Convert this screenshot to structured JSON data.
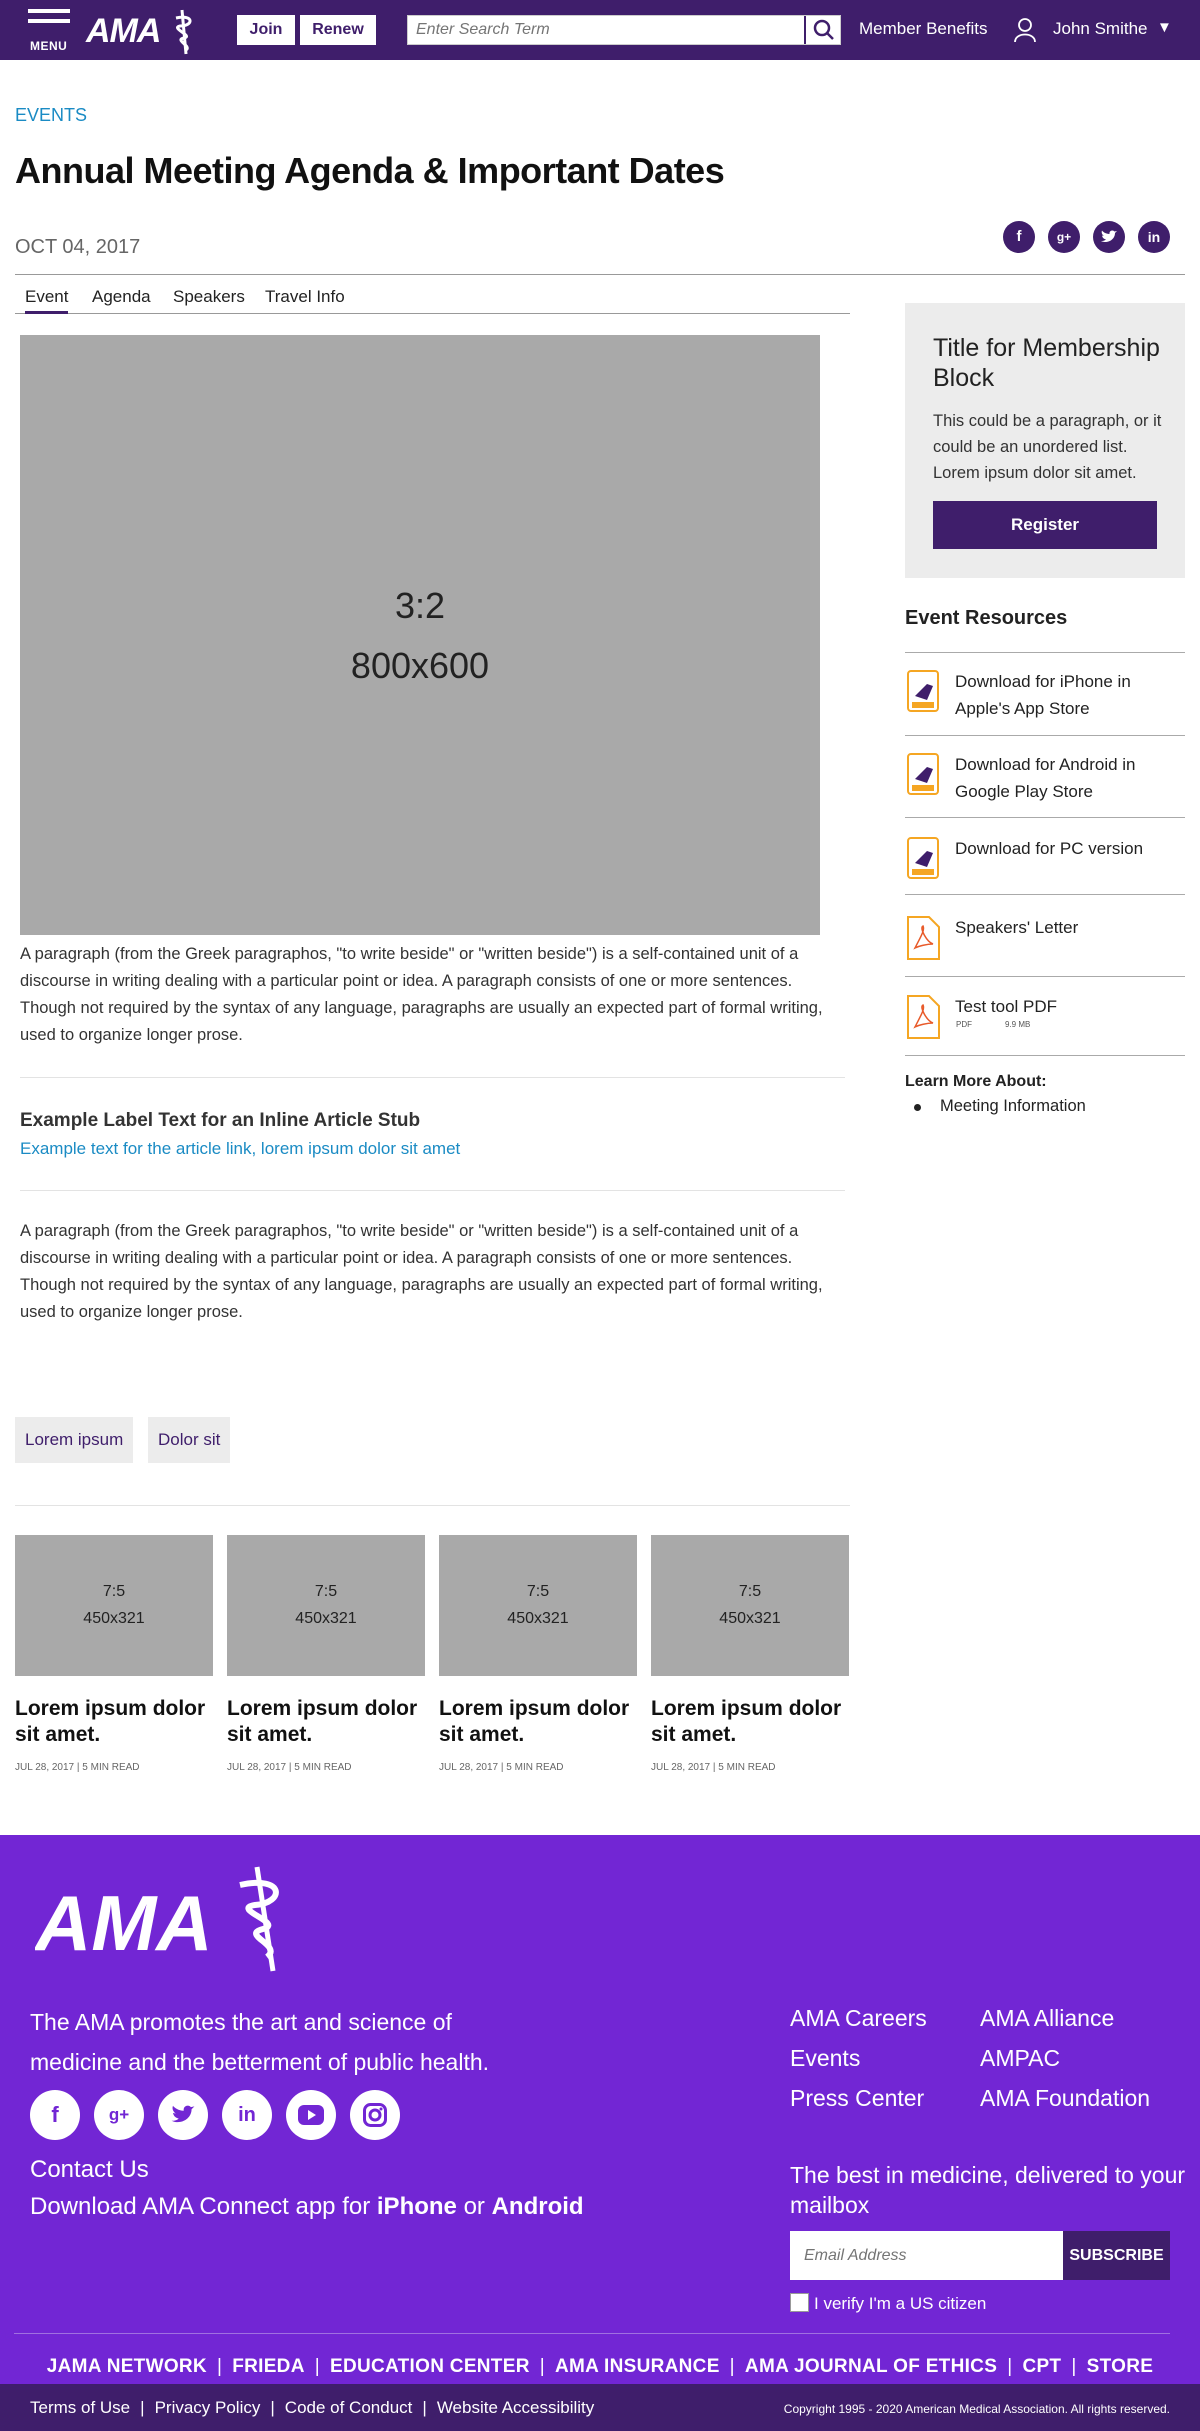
{
  "header": {
    "menu_label": "MENU",
    "logo_text": "AMA",
    "join_label": "Join",
    "renew_label": "Renew",
    "search_placeholder": "Enter Search Term",
    "member_benefits": "Member Benefits",
    "user_name": "John Smithe",
    "user_caret": "▼",
    "brand_color": "#3f1e6b"
  },
  "article": {
    "category": "EVENTS",
    "title": "Annual Meeting Agenda & Important Dates",
    "date": "OCT 04, 2017",
    "social_icons": [
      "facebook-icon",
      "google-plus-icon",
      "twitter-icon",
      "linkedin-icon"
    ],
    "tabs": [
      "Event",
      "Agenda",
      "Speakers",
      "Travel Info"
    ],
    "active_tab": "Event",
    "hero_ratio": "3:2",
    "hero_size": "800x600",
    "paragraph_1": "A paragraph (from the Greek paragraphos, \"to write beside\" or \"written beside\") is a self-contained unit of a discourse in writing dealing with a particular point or idea. A paragraph consists of one or more sentences. Though not required by the syntax of any language, paragraphs are usually an expected part of formal writing, used to organize longer prose.",
    "stub_label": "Example Label Text for an Inline Article Stub",
    "stub_link": "Example text for the article link, lorem ipsum dolor sit amet",
    "paragraph_2": "A paragraph (from the Greek paragraphos, \"to write beside\" or \"written beside\") is a self-contained unit of a discourse in writing dealing with a particular point or idea. A paragraph consists of one or more sentences. Though not required by the syntax of any language, paragraphs are usually an expected part of formal writing, used to organize longer prose.",
    "tags": [
      "Lorem ipsum",
      "Dolor sit"
    ]
  },
  "related_cards": [
    {
      "ratio": "7:5",
      "size": "450x321",
      "title": "Lorem ipsum dolor sit amet.",
      "meta": "JUL 28, 2017 | 5 MIN READ"
    },
    {
      "ratio": "7:5",
      "size": "450x321",
      "title": "Lorem ipsum dolor sit amet.",
      "meta": "JUL 28, 2017 | 5 MIN READ"
    },
    {
      "ratio": "7:5",
      "size": "450x321",
      "title": "Lorem ipsum dolor sit amet.",
      "meta": "JUL 28, 2017 | 5 MIN READ"
    },
    {
      "ratio": "7:5",
      "size": "450x321",
      "title": "Lorem ipsum dolor sit amet.",
      "meta": "JUL 28, 2017 | 5 MIN READ"
    }
  ],
  "sidebar": {
    "membership_title": "Title for Membership Block",
    "membership_text": "This could be a paragraph, or it could be an unordered list. Lorem ipsum dolor sit amet.",
    "register_label": "Register",
    "resources_title": "Event Resources",
    "resources": [
      {
        "label": "Download for iPhone in Apple's App Store",
        "icon": "app-download-icon"
      },
      {
        "label": "Download for Android in Google Play Store",
        "icon": "app-download-icon"
      },
      {
        "label": "Download for PC version",
        "icon": "app-download-icon"
      },
      {
        "label": "Speakers' Letter",
        "icon": "pdf-icon"
      },
      {
        "label": "Test tool PDF",
        "icon": "pdf-icon",
        "type": "PDF",
        "size": "9.9 MB"
      }
    ],
    "learn_more_title": "Learn More About:",
    "learn_more_items": [
      "Meeting Information"
    ]
  },
  "footer": {
    "logo_text": "AMA",
    "tagline": "The AMA promotes the art and science of medicine and the betterment of public health.",
    "social_icons": [
      "facebook-icon",
      "google-plus-icon",
      "twitter-icon",
      "linkedin-icon",
      "youtube-icon",
      "instagram-icon"
    ],
    "contact_us": "Contact Us",
    "app_prefix": "Download AMA Connect app for",
    "app_iphone": "iPhone",
    "app_or": "or",
    "app_android": "Android",
    "links_col1": [
      "AMA Careers",
      "Events",
      "Press Center"
    ],
    "links_col2": [
      "AMA Alliance",
      "AMPAC",
      "AMA Foundation"
    ],
    "mailbox_text": "The best in medicine, delivered to your mailbox",
    "email_placeholder": "Email Address",
    "subscribe_label": "SUBSCRIBE",
    "verify_label": "I verify I'm a US citizen",
    "brands": [
      "JAMA NETWORK",
      "FRIEDA",
      "EDUCATION CENTER",
      "AMA INSURANCE",
      "AMA JOURNAL OF ETHICS",
      "CPT",
      "STORE"
    ],
    "bottom_links": [
      "Terms of Use",
      "Privacy Policy",
      "Code of Conduct",
      "Website Accessibility"
    ],
    "copyright": "Copyright 1995 - 2020 American Medical Association. All rights reserved.",
    "footer_color": "#7226d4"
  }
}
